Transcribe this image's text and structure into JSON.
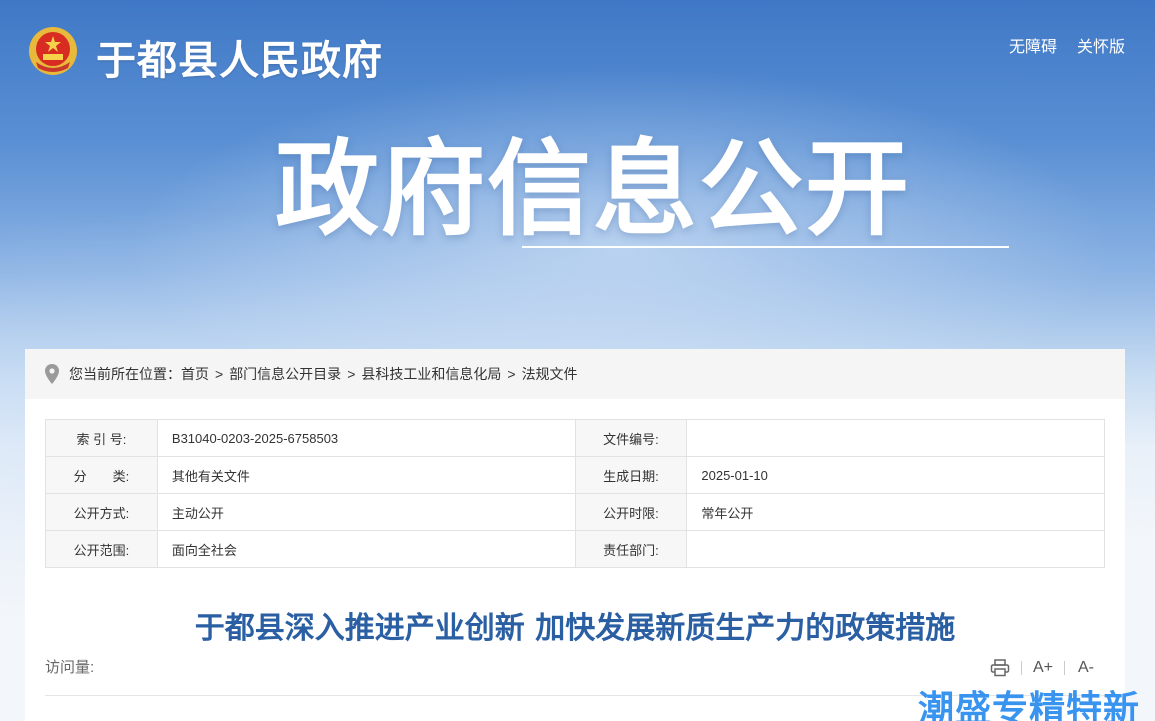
{
  "header": {
    "site_title": "于都县人民政府",
    "links": [
      "无障碍",
      "关怀版"
    ]
  },
  "hero": {
    "title": "政府信息公开"
  },
  "breadcrumb": {
    "prefix": "您当前所在位置：",
    "items": [
      "首页",
      "部门信息公开目录",
      "县科技工业和信息化局",
      "法规文件"
    ],
    "separator": ">"
  },
  "meta": {
    "rows": [
      {
        "l1": "索 引 号:",
        "v1": "B31040-0203-2025-6758503",
        "l2": "文件编号:",
        "v2": ""
      },
      {
        "l1": "分　　类:",
        "v1": "其他有关文件",
        "l2": "生成日期:",
        "v2": "2025-01-10"
      },
      {
        "l1": "公开方式:",
        "v1": "主动公开",
        "l2": "公开时限:",
        "v2": "常年公开"
      },
      {
        "l1": "公开范围:",
        "v1": "面向全社会",
        "l2": "责任部门:",
        "v2": ""
      }
    ]
  },
  "article": {
    "title": "于都县深入推进产业创新 加快发展新质生产力的政策措施",
    "visits_label": "访问量:"
  },
  "tools": {
    "font_increase": "A+",
    "font_decrease": "A-"
  },
  "watermark": "潮盛专精特新",
  "colors": {
    "accent": "#2b5fa3",
    "banner_top": "#3f78c6",
    "watermark": "#2f8ff0"
  }
}
